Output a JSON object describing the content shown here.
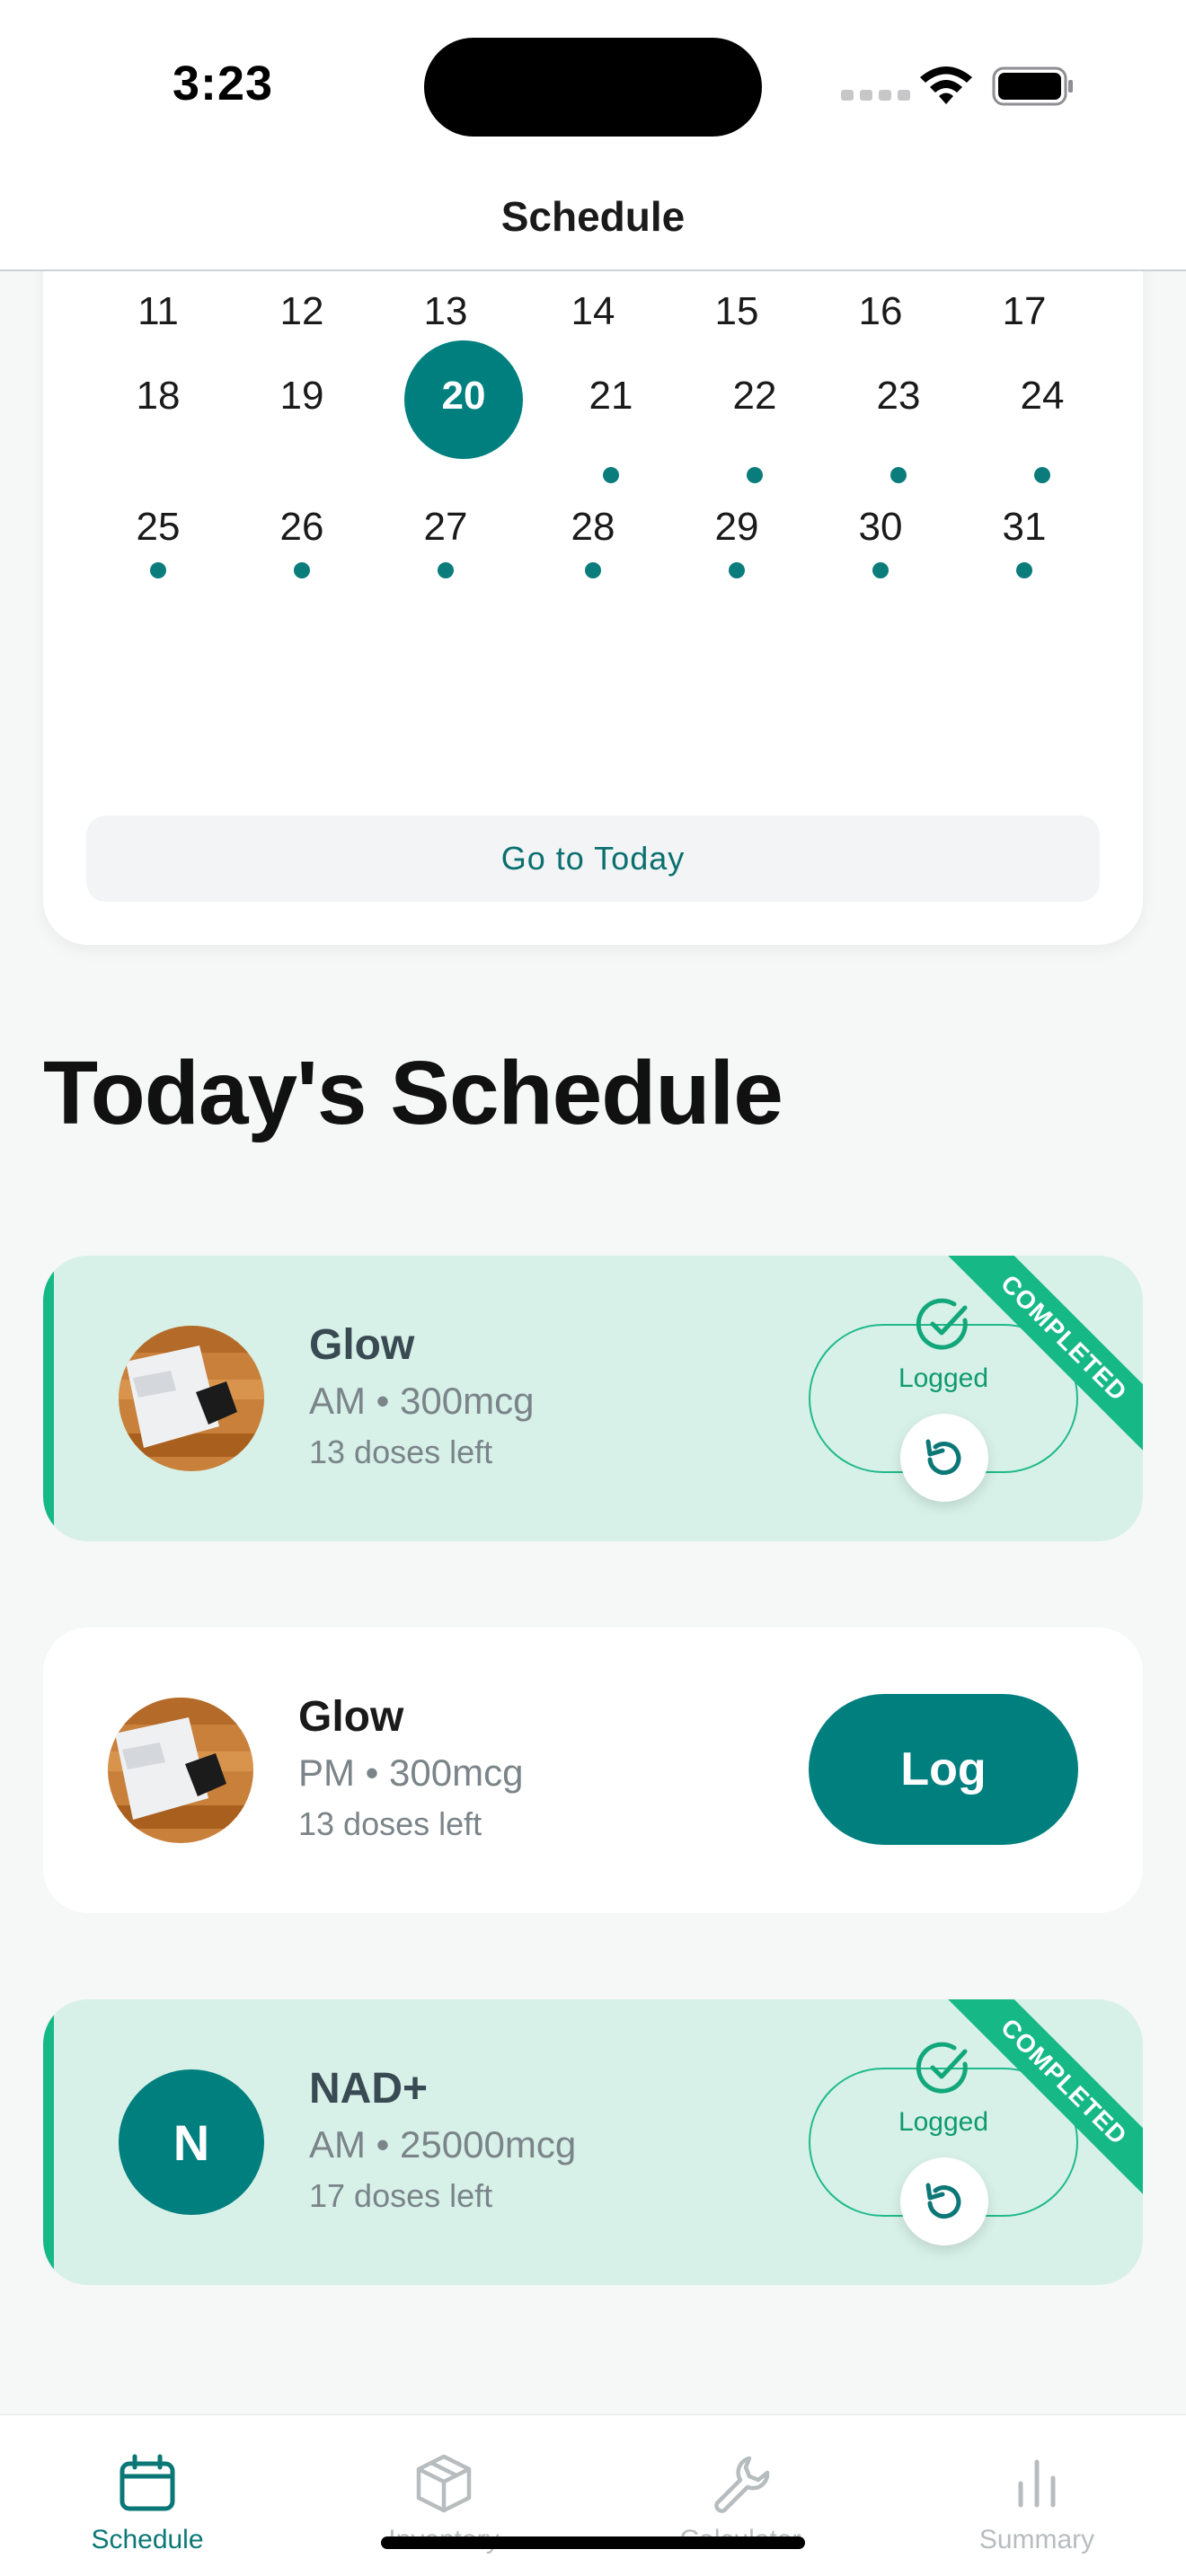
{
  "status_bar": {
    "time": "3:23"
  },
  "nav": {
    "title": "Schedule"
  },
  "calendar": {
    "rows": [
      {
        "days": [
          "11",
          "12",
          "13",
          "14",
          "15",
          "16",
          "17"
        ],
        "dots": []
      },
      {
        "days": [
          "18",
          "19",
          "20",
          "21",
          "22",
          "23",
          "24"
        ],
        "dots": [
          "21",
          "22",
          "23",
          "24"
        ]
      },
      {
        "days": [
          "25",
          "26",
          "27",
          "28",
          "29",
          "30",
          "31"
        ],
        "dots": [
          "25",
          "26",
          "27",
          "28",
          "29",
          "30",
          "31"
        ]
      }
    ],
    "selected_day": "20",
    "today_button": "Go to Today"
  },
  "section_title": "Today's Schedule",
  "schedule": [
    {
      "name": "Glow",
      "detail": "AM • 300mcg",
      "doses_left": "13 doses left",
      "status": "completed",
      "logged_label": "Logged",
      "ribbon": "COMPLETED",
      "avatar": "photo"
    },
    {
      "name": "Glow",
      "detail": "PM • 300mcg",
      "doses_left": "13 doses left",
      "status": "pending",
      "log_label": "Log",
      "avatar": "photo"
    },
    {
      "name": "NAD+",
      "detail": "AM • 25000mcg",
      "doses_left": "17 doses left",
      "status": "completed",
      "logged_label": "Logged",
      "ribbon": "COMPLETED",
      "avatar": "letter",
      "avatar_letter": "N"
    }
  ],
  "tabs": [
    {
      "label": "Schedule",
      "icon": "calendar-icon",
      "active": true
    },
    {
      "label": "Inventory",
      "icon": "box-icon",
      "active": false
    },
    {
      "label": "Calculator",
      "icon": "wrench-icon",
      "active": false
    },
    {
      "label": "Summary",
      "icon": "bar-chart-icon",
      "active": false
    }
  ],
  "colors": {
    "accent": "#007f7f",
    "completed_bg": "#d7f1e8",
    "completed_stripe": "#16b886"
  }
}
